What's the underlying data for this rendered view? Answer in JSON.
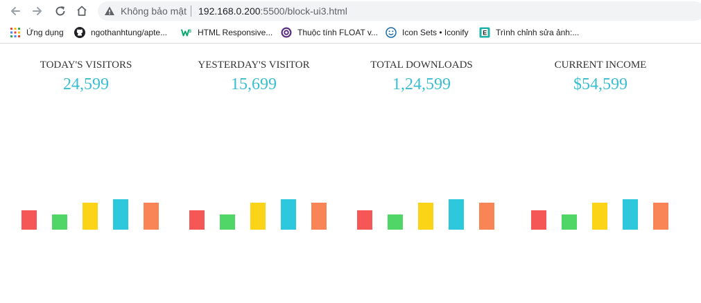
{
  "browser": {
    "security_label": "Không bảo mật",
    "url_host": "192.168.0.200",
    "url_rest": ":5500/block-ui3.html"
  },
  "bookmarks": [
    {
      "label": "Ứng dụng",
      "icon": "apps-grid-icon"
    },
    {
      "label": "ngothanhtung/apte...",
      "icon": "github-icon"
    },
    {
      "label": "HTML Responsive...",
      "icon": "w3-icon"
    },
    {
      "label": "Thuộc tính FLOAT v...",
      "icon": "at-sign-icon"
    },
    {
      "label": "Icon Sets • Iconify",
      "icon": "smiley-icon"
    },
    {
      "label": "Trình chỉnh sửa ảnh:...",
      "icon": "editor-e-icon"
    }
  ],
  "stats": [
    {
      "label": "TODAY'S VISITORS",
      "value": "24,599"
    },
    {
      "label": "YESTERDAY'S VISITOR",
      "value": "15,699"
    },
    {
      "label": "TOTAL DOWNLOADS",
      "value": "1,24,599"
    },
    {
      "label": "CURRENT INCOME",
      "value": "$54,599"
    }
  ],
  "bar_colors": [
    "#f55656",
    "#4fd666",
    "#fcd417",
    "#2ec8dc",
    "#f98556"
  ],
  "bar_levels": [
    0.5,
    0.4,
    0.7,
    0.8,
    0.7
  ]
}
